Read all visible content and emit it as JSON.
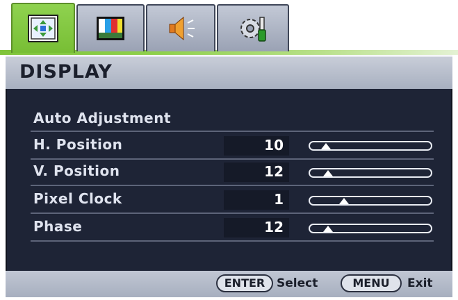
{
  "tabs": [
    {
      "icon": "display-icon",
      "active": true
    },
    {
      "icon": "picture-icon",
      "active": false
    },
    {
      "icon": "audio-icon",
      "active": false
    },
    {
      "icon": "system-settings-icon",
      "active": false
    }
  ],
  "header": {
    "title": "DISPLAY"
  },
  "menu": {
    "auto_adjustment": "Auto Adjustment",
    "items": [
      {
        "label": "H. Position",
        "value": "10",
        "level": 0.1
      },
      {
        "label": "V. Position",
        "value": "12",
        "level": 0.12
      },
      {
        "label": "Pixel Clock",
        "value": "1",
        "level": 0.26
      },
      {
        "label": "Phase",
        "value": "12",
        "level": 0.12
      }
    ]
  },
  "footer": {
    "enter_key": "ENTER",
    "enter_action": "Select",
    "menu_key": "MENU",
    "menu_action": "Exit"
  },
  "colors": {
    "active_tab": "#8fd24f",
    "panel_bg": "#1e2436",
    "title_bg": "#b8bfcc"
  }
}
